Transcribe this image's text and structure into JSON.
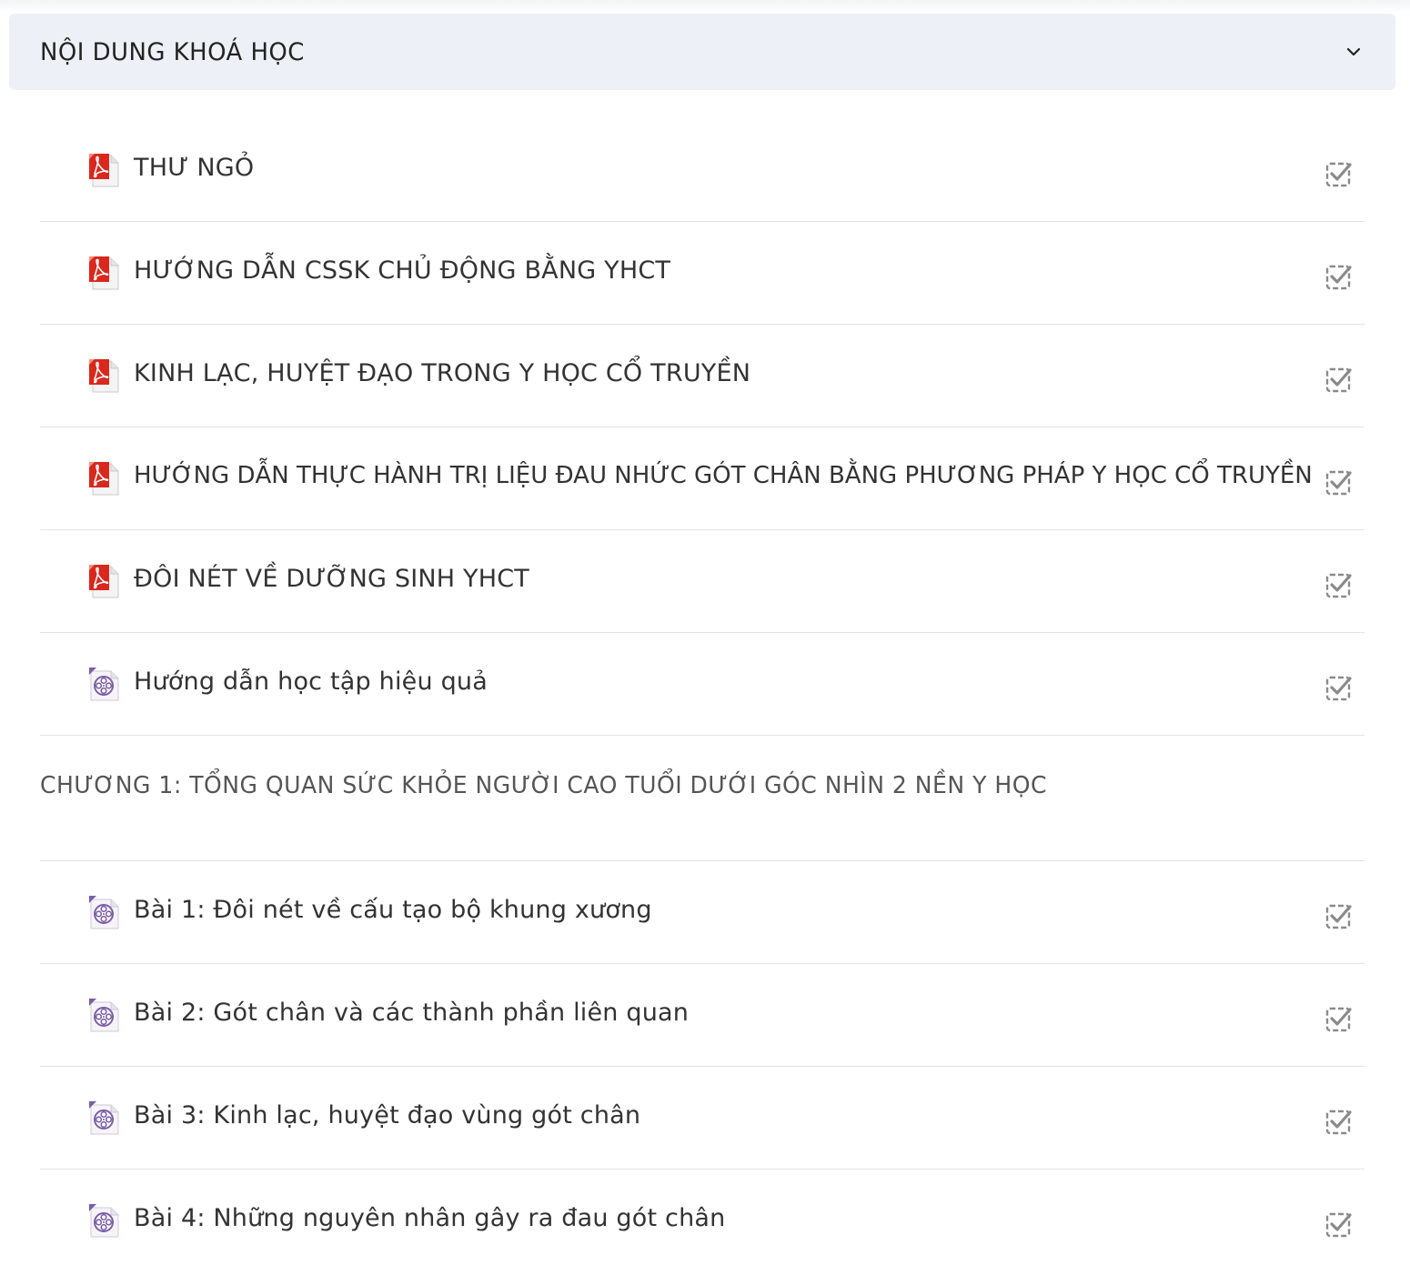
{
  "accordion": {
    "title": "NỘI DUNG KHOÁ HỌC",
    "toggle_icon": "chevron-down-icon"
  },
  "lessons_intro": [
    {
      "label": "THƯ NGỎ",
      "icon": "pdf-icon"
    },
    {
      "label": "HƯỚNG DẪN CSSK CHỦ ĐỘNG BẰNG YHCT",
      "icon": "pdf-icon"
    },
    {
      "label": "KINH LẠC, HUYỆT ĐẠO TRONG Y HỌC CỔ TRUYỀN",
      "icon": "pdf-icon"
    },
    {
      "label": "HƯỚNG DẪN THỰC HÀNH TRỊ LIỆU ĐAU NHỨC GÓT CHÂN BẰNG PHƯƠNG PHÁP Y HỌC CỔ TRUYỀN",
      "icon": "pdf-icon"
    },
    {
      "label": "ĐÔI NÉT VỀ DƯỠNG SINH YHCT",
      "icon": "pdf-icon"
    },
    {
      "label": "Hướng dẫn học tập hiệu quả",
      "icon": "video-icon"
    }
  ],
  "chapter1": {
    "title": "CHƯƠNG 1: TỔNG QUAN SỨC KHỎE NGƯỜI CAO TUỔI DƯỚI GÓC NHÌN 2 NỀN Y HỌC",
    "lessons": [
      {
        "label": "Bài 1: Đôi nét về cấu tạo bộ khung xương",
        "icon": "video-icon"
      },
      {
        "label": "Bài 2: Gót chân và các thành phần liên quan",
        "icon": "video-icon"
      },
      {
        "label": "Bài 3: Kinh lạc, huyệt đạo vùng gót chân",
        "icon": "video-icon"
      },
      {
        "label": "Bài 4: Những nguyên nhân gây ra đau gót chân",
        "icon": "video-icon"
      }
    ]
  },
  "colors": {
    "header_bg": "#edf0f6",
    "pdf_red": "#d9281c",
    "video_purple": "#7b5ea7",
    "check_gray": "#8a8a8a"
  }
}
